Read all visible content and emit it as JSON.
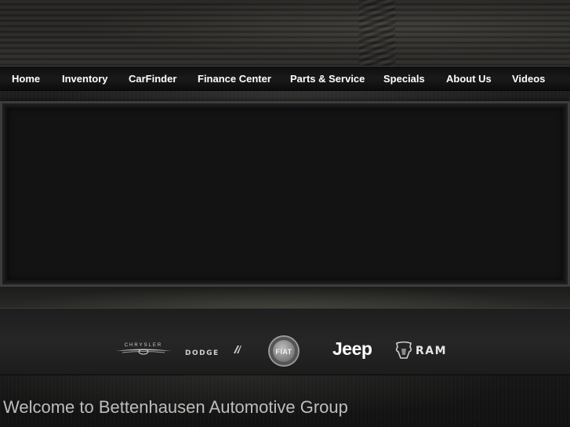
{
  "nav": {
    "items": [
      {
        "label": "Home"
      },
      {
        "label": "Inventory"
      },
      {
        "label": "CarFinder"
      },
      {
        "label": "Finance Center"
      },
      {
        "label": "Parts & Service"
      },
      {
        "label": "Specials"
      },
      {
        "label": "About Us"
      },
      {
        "label": "Videos"
      }
    ]
  },
  "brands": {
    "chrysler": "CHRYSLER",
    "dodge": "DODGE",
    "fiat": "FIAT",
    "jeep": "Jeep",
    "ram": "RAM"
  },
  "welcome": "Welcome to Bettenhausen Automotive Group"
}
